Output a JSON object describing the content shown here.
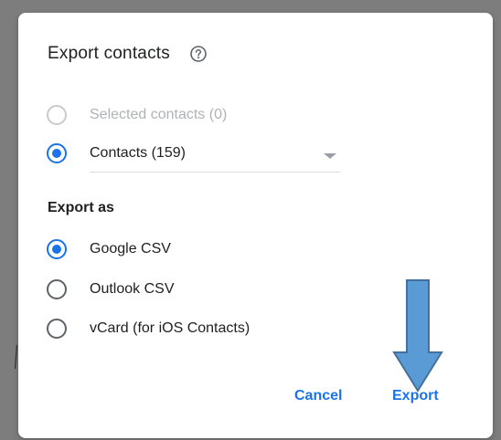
{
  "dialog": {
    "title": "Export contacts",
    "help_icon": "help-circle-icon",
    "source_options": [
      {
        "label": "Selected contacts (0)",
        "checked": false,
        "disabled": true
      },
      {
        "label": "Contacts (159)",
        "checked": true,
        "disabled": false
      }
    ],
    "export_as_label": "Export as",
    "format_options": [
      {
        "label": "Google CSV",
        "checked": true
      },
      {
        "label": "Outlook CSV",
        "checked": false
      },
      {
        "label": "vCard (for iOS Contacts)",
        "checked": false
      }
    ],
    "cancel_label": "Cancel",
    "export_label": "Export"
  },
  "annotation": {
    "arrow_icon": "down-arrow-icon",
    "arrow_color": "#5b9bd5"
  },
  "colors": {
    "accent": "#1a73e8",
    "backdrop": "#7d7d7d"
  }
}
